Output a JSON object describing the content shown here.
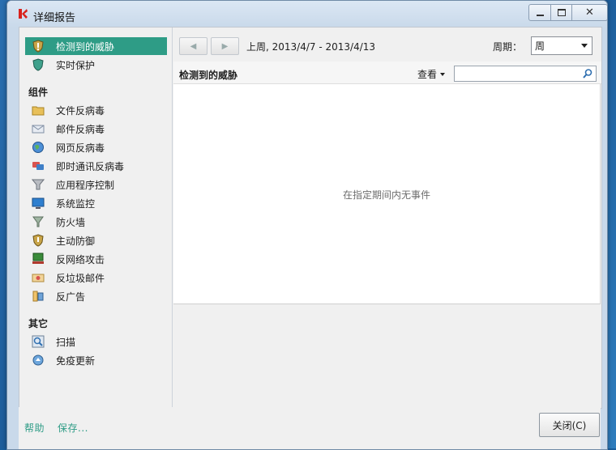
{
  "window": {
    "title": "详细报告"
  },
  "sidebar": {
    "top_items": [
      {
        "label": "检测到的威胁",
        "selected": true,
        "icon": "threat-shield-icon"
      },
      {
        "label": "实时保护",
        "selected": false,
        "icon": "protection-shield-icon"
      }
    ],
    "components_header": "组件",
    "components": [
      {
        "label": "文件反病毒",
        "icon": "folder-icon"
      },
      {
        "label": "邮件反病毒",
        "icon": "mail-icon"
      },
      {
        "label": "网页反病毒",
        "icon": "globe-icon"
      },
      {
        "label": "即时通讯反病毒",
        "icon": "im-icon"
      },
      {
        "label": "应用程序控制",
        "icon": "funnel-icon"
      },
      {
        "label": "系统监控",
        "icon": "monitor-icon"
      },
      {
        "label": "防火墙",
        "icon": "firewall-icon"
      },
      {
        "label": "主动防御",
        "icon": "defense-shield-icon"
      },
      {
        "label": "反网络攻击",
        "icon": "network-attack-icon"
      },
      {
        "label": "反垃圾邮件",
        "icon": "spam-icon"
      },
      {
        "label": "反广告",
        "icon": "ad-icon"
      }
    ],
    "other_header": "其它",
    "other": [
      {
        "label": "扫描",
        "icon": "scan-icon"
      },
      {
        "label": "免疫更新",
        "icon": "update-icon"
      }
    ]
  },
  "toolbar": {
    "period_text": "上周, 2013/4/7 - 2013/4/13",
    "period_label": "周期：",
    "period_value": "周"
  },
  "section": {
    "title": "检测到的威胁",
    "view_label": "查看",
    "search_value": ""
  },
  "content": {
    "empty_message": "在指定期间内无事件"
  },
  "footer": {
    "help_label": "帮助",
    "save_label": "保存...",
    "close_label": "关闭(C)"
  },
  "colors": {
    "accent": "#2e9c86",
    "selected_bg": "#2e9c86"
  }
}
